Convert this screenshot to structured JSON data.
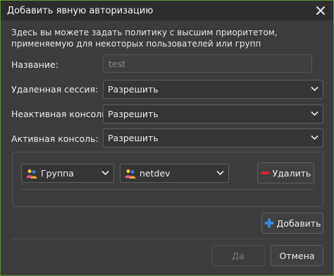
{
  "window": {
    "title": "Добавить явную авторизацию"
  },
  "description": "Здесь вы можете задать политику с высшим приоритетом, применяемую для некоторых пользователей или групп",
  "form": {
    "name_label": "Название:",
    "name_placeholder": "test",
    "remote_label": "Удаленная сессия:",
    "remote_value": "Разрешить",
    "inactive_label": "Неактивная консоль:",
    "inactive_value": "Разрешить",
    "active_label": "Активная консоль:",
    "active_value": "Разрешить"
  },
  "entry": {
    "type_value": "Группа",
    "group_value": "netdev",
    "remove_label": "Удалить"
  },
  "buttons": {
    "add_label": "Добавить",
    "ok_label": "Да",
    "cancel_label": "Отмена"
  },
  "icons": {
    "close": "close-icon",
    "chevron": "chevron-down-icon",
    "users": "users-icon",
    "remove": "minus-icon",
    "add": "plus-icon"
  },
  "colors": {
    "accent_border": "#5b9236",
    "remove_icon": "#e0242f",
    "add_icon": "#3a89d8"
  }
}
